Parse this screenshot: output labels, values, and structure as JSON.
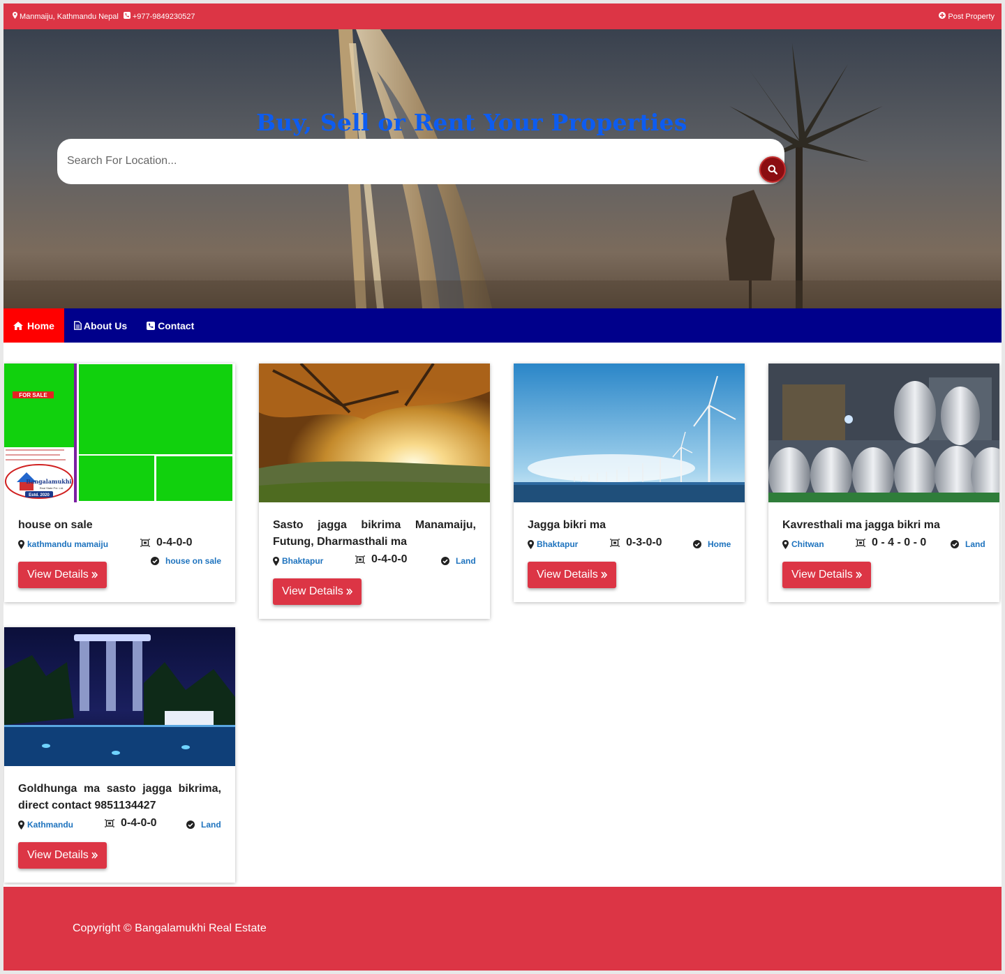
{
  "topbar": {
    "address": "Manmaiju, Kathmandu Nepal",
    "phone": "+977-9849230527",
    "post_property": "Post Property"
  },
  "hero": {
    "title": "Buy, Sell or Rent Your Properties",
    "search_placeholder": "Search For Location..."
  },
  "nav": {
    "home": "Home",
    "about": "About Us",
    "contact": "Contact"
  },
  "thumb_text": {
    "for_sale": "FOR SALE",
    "logo_name": "Bangalamukhi",
    "logo_sub": "Real State Pvt. Ltd.",
    "logo_est": "Estd. 2020"
  },
  "listings": [
    {
      "title": "house on sale",
      "location": "kathmandu mamaiju",
      "area": "0-4-0-0",
      "category": "house on sale",
      "button": "View Details"
    },
    {
      "title": "Sasto jagga bikrima Manamaiju, Futung, Dharmasthali ma",
      "location": "Bhaktapur",
      "area": "0-4-0-0",
      "category": "Land",
      "button": "View Details"
    },
    {
      "title": "Jagga bikri ma",
      "location": "Bhaktapur",
      "area": "0-3-0-0",
      "category": "Home",
      "button": "View Details"
    },
    {
      "title": "Kavresthali ma jagga bikri ma",
      "location": "Chitwan",
      "area": "0 - 4 - 0 - 0",
      "category": "Land",
      "button": "View Details"
    },
    {
      "title": "Goldhunga ma sasto jagga bikrima, direct contact 9851134427",
      "location": "Kathmandu",
      "area": "0-4-0-0",
      "category": "Land",
      "button": "View Details"
    }
  ],
  "footer": {
    "copyright": "Copyright © Bangalamukhi Real Estate"
  },
  "colors": {
    "topbar": "#dc3545",
    "nav": "#00008b",
    "nav_active": "#ff0000",
    "hero_title": "#0d5cf0",
    "link": "#1e73be",
    "button": "#dc3545",
    "search_button": "#8b0d11"
  },
  "icons": {
    "address": "map-marker-icon",
    "phone": "phone-icon",
    "post": "plus-circle-icon",
    "search": "search-icon",
    "home": "home-icon",
    "about": "file-icon",
    "contact": "phone-square-icon",
    "location": "map-marker-icon",
    "area": "area-ruler-icon",
    "category": "check-circle-icon",
    "button": "double-chevron-right-icon"
  }
}
